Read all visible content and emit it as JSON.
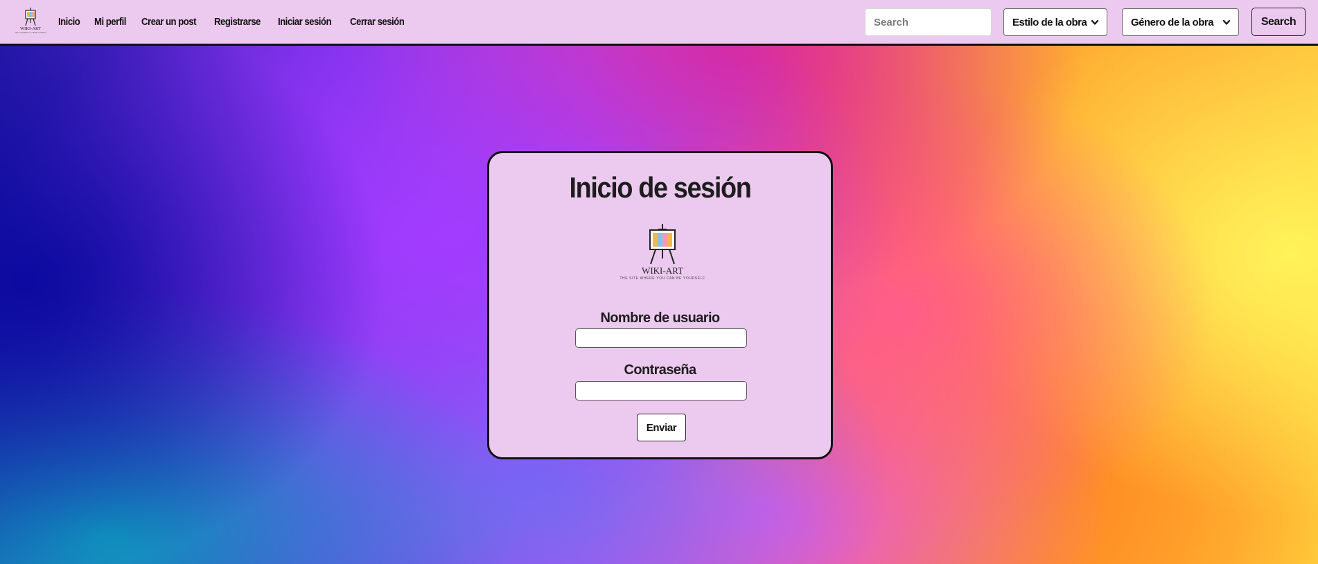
{
  "brand": {
    "logo_text": "WIKI-ART",
    "tagline": "THE SITE WHERE YOU CAN BE YOURSELF",
    "icon": "easel-painting-icon"
  },
  "nav": {
    "links": [
      {
        "label": "Inicio"
      },
      {
        "label": "Mi perfil"
      },
      {
        "label": "Crear un post"
      },
      {
        "label": "Registrarse"
      },
      {
        "label": "Iniciar sesión"
      },
      {
        "label": "Cerrar sesión"
      }
    ],
    "search": {
      "placeholder": "Search",
      "value": ""
    },
    "style_select": {
      "selected": "Estilo de la obra"
    },
    "genre_select": {
      "selected": "Género de la obra"
    },
    "search_button": "Search"
  },
  "login": {
    "title": "Inicio de sesión",
    "username_label": "Nombre de usuario",
    "username_value": "",
    "password_label": "Contraseña",
    "password_value": "",
    "submit_label": "Enviar"
  },
  "colors": {
    "nav_background": "#ecc9ee",
    "card_background": "#ecc9ee",
    "border": "#111111"
  }
}
